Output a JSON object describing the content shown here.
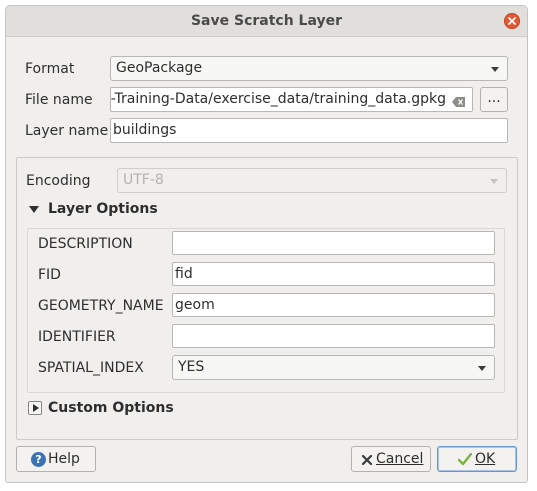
{
  "window": {
    "title": "Save Scratch Layer"
  },
  "format": {
    "label": "Format",
    "value": "GeoPackage"
  },
  "file": {
    "label": "File name",
    "value": "s-Training-Data/exercise_data/training_data.gpkg",
    "browse_label": "..."
  },
  "layer": {
    "label": "Layer name",
    "value": "buildings"
  },
  "encoding": {
    "label": "Encoding",
    "value": "UTF-8"
  },
  "layer_options": {
    "header": "Layer Options",
    "rows": [
      {
        "label": "DESCRIPTION",
        "value": ""
      },
      {
        "label": "FID",
        "value": "fid"
      },
      {
        "label": "GEOMETRY_NAME",
        "value": "geom"
      },
      {
        "label": "IDENTIFIER",
        "value": ""
      },
      {
        "label": "SPATIAL_INDEX",
        "value": "YES"
      }
    ]
  },
  "custom_options": {
    "header": "Custom Options"
  },
  "buttons": {
    "help": "Help",
    "cancel": "Cancel",
    "ok": "OK"
  },
  "colors": {
    "close": "#e05a37",
    "ok_border": "#6b97c7",
    "titlebar": "#e1dfdc"
  }
}
